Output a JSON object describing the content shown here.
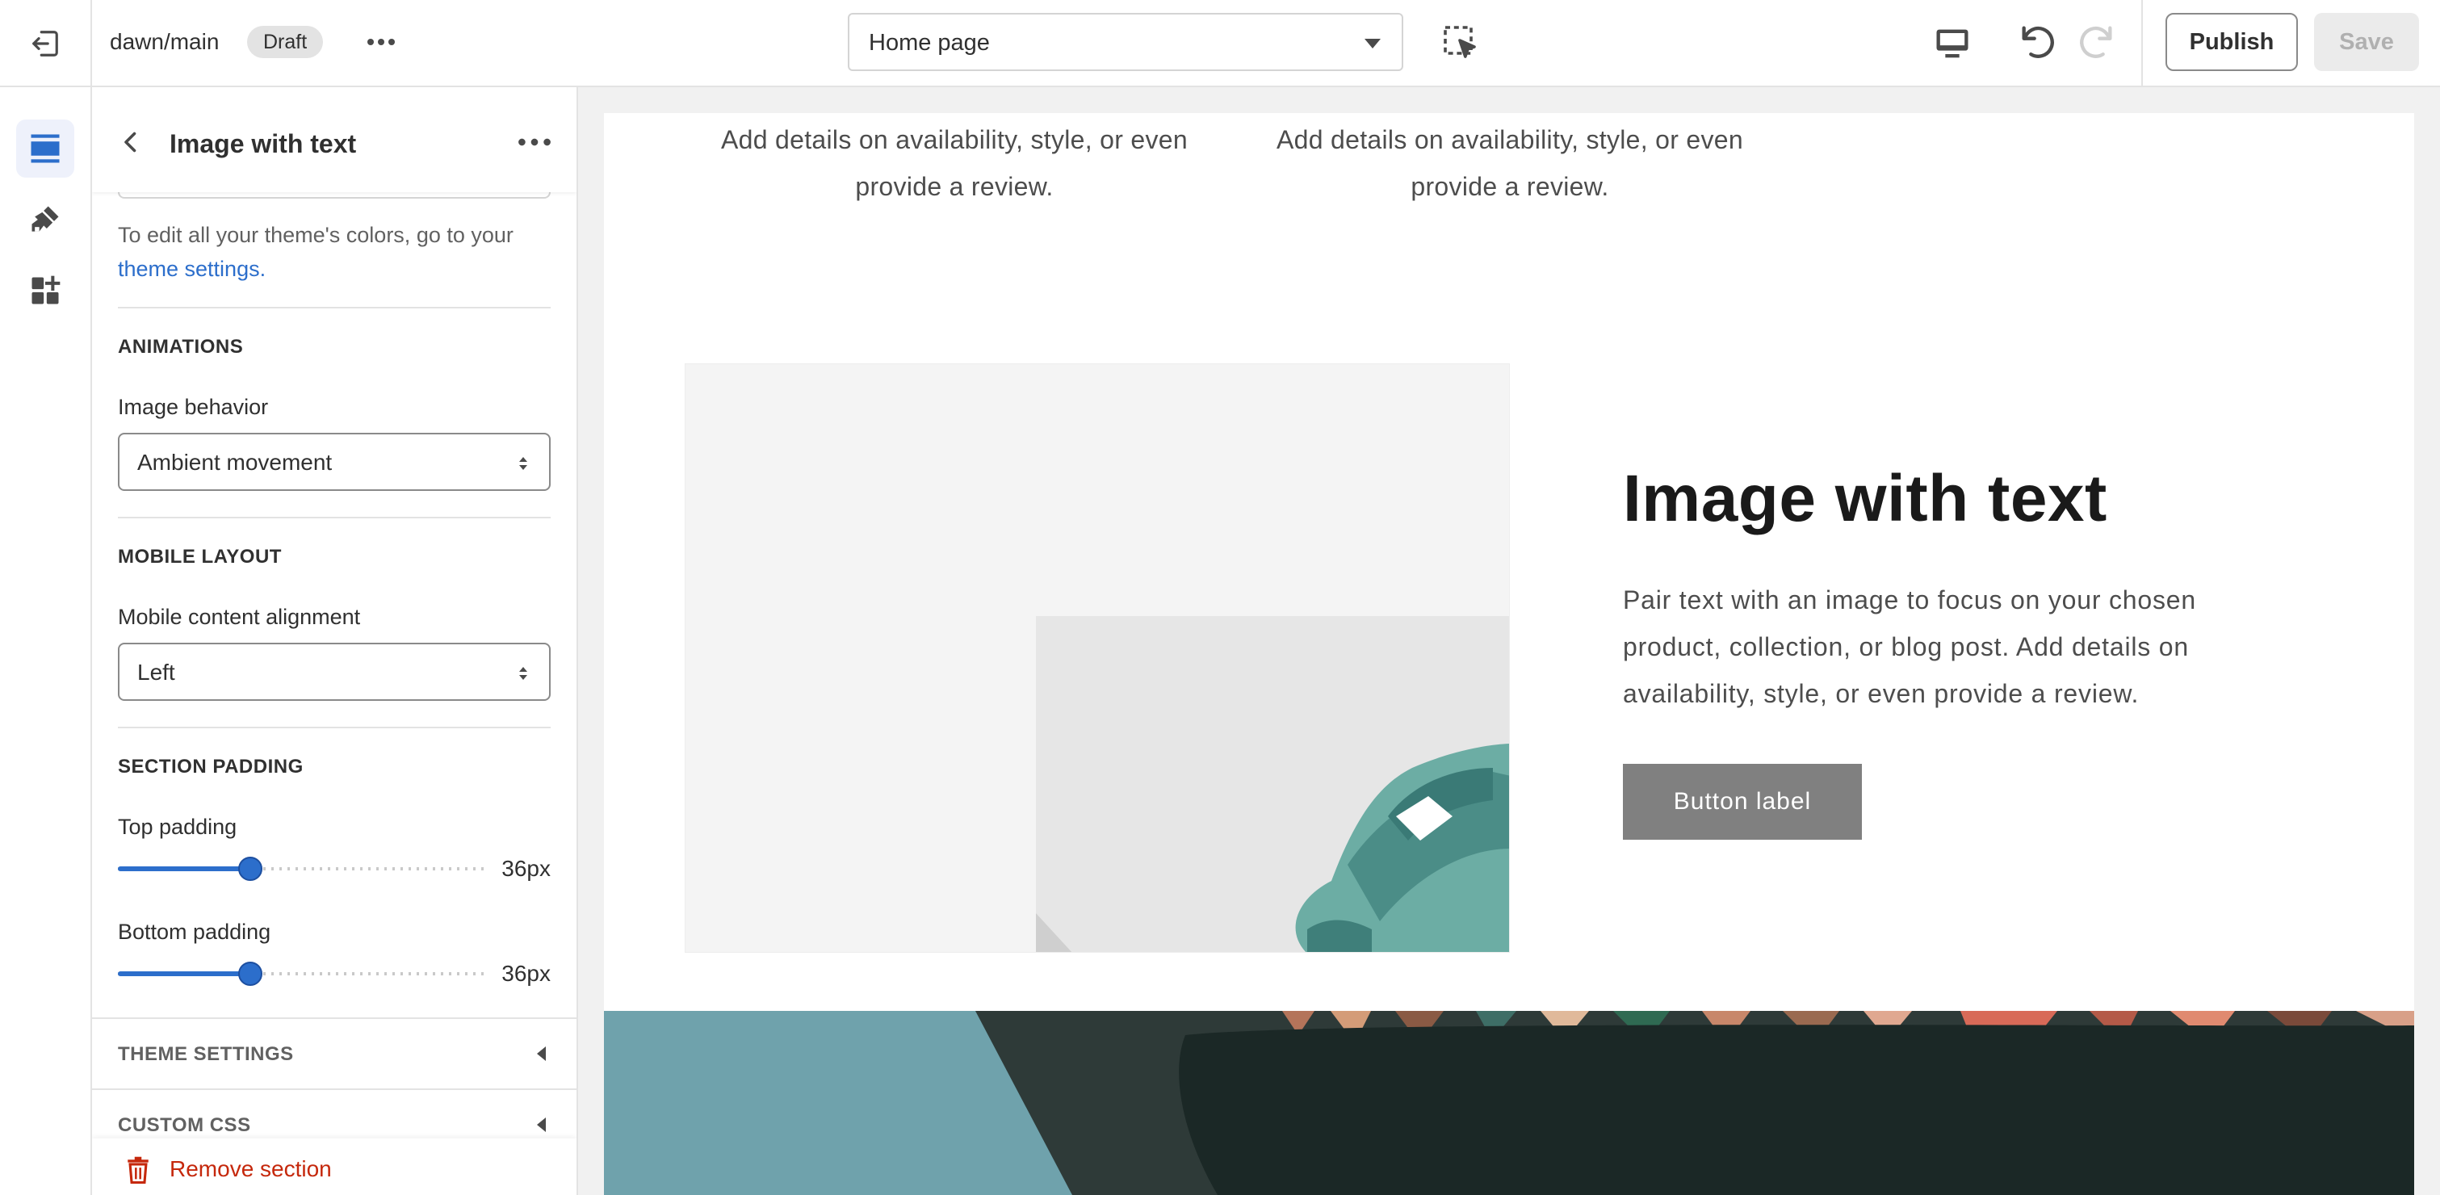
{
  "topbar": {
    "theme_name": "dawn/main",
    "status_badge": "Draft",
    "page_selector": "Home page",
    "publish_label": "Publish",
    "save_label": "Save"
  },
  "rail": {
    "items": [
      "sections-icon",
      "brush-icon",
      "apps-icon"
    ]
  },
  "panel": {
    "title": "Image with text",
    "colors_hint": "To edit all your theme's colors, go to your",
    "colors_hint_link": "theme settings.",
    "animations": {
      "title": "ANIMATIONS",
      "image_behavior_label": "Image behavior",
      "image_behavior_value": "Ambient movement"
    },
    "mobile_layout": {
      "title": "MOBILE LAYOUT",
      "alignment_label": "Mobile content alignment",
      "alignment_value": "Left"
    },
    "section_padding": {
      "title": "SECTION PADDING",
      "top_label": "Top padding",
      "top_value": "36px",
      "top_fraction": 0.36,
      "bottom_label": "Bottom padding",
      "bottom_value": "36px",
      "bottom_fraction": 0.36
    },
    "theme_settings_label": "THEME SETTINGS",
    "custom_css_label": "CUSTOM CSS",
    "remove_label": "Remove section"
  },
  "preview": {
    "column_text_1": "Add details on availability, style, or even provide a review.",
    "column_text_2": "Add details on availability, style, or even provide a review.",
    "heading": "Image with text",
    "body": "Pair text with an image to focus on your chosen product, collection, or blog post. Add details on availability, style, or even provide a review.",
    "button_label": "Button label"
  },
  "colors": {
    "accent": "#2c6ecb",
    "danger": "#c5280c",
    "preview_button": "#808080",
    "banner_bg": "#6fa2ac"
  }
}
